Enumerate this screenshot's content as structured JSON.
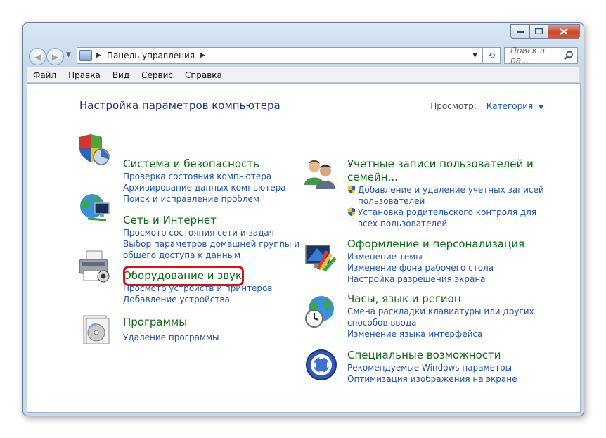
{
  "window": {
    "breadcrumb": "Панель управления",
    "search_placeholder": "Поиск в па..."
  },
  "menu": [
    "Файл",
    "Правка",
    "Вид",
    "Сервис",
    "Справка"
  ],
  "header": {
    "title": "Настройка параметров компьютера",
    "view_label": "Просмотр:",
    "view_value": "Категория"
  },
  "left_categories": [
    {
      "title": "Система и безопасность",
      "icon": "shield-icon",
      "links": [
        "Проверка состояния компьютера",
        "Архивирование данных компьютера",
        "Поиск и исправление проблем"
      ]
    },
    {
      "title": "Сеть и Интернет",
      "icon": "network-globe-icon",
      "links": [
        "Просмотр состояния сети и задач",
        "Выбор параметров домашней группы и",
        "общего доступа к данным"
      ]
    },
    {
      "title": "Оборудование и звук",
      "icon": "printer-icon",
      "links": [
        "Просмотр устройств и принтеров",
        "Добавление устройства"
      ]
    },
    {
      "title": "Программы",
      "icon": "programs-disc-icon",
      "links": [
        "Удаление программы"
      ]
    }
  ],
  "right_categories": [
    {
      "title_line1": "Учетные записи пользователей и",
      "title_line2": "семейн...",
      "icon": "users-icon",
      "links": [
        "Добавление и удаление учетных записей",
        "пользователей",
        "Установка родительского контроля для",
        "всех пользователей"
      ]
    },
    {
      "title": "Оформление и персонализация",
      "icon": "display-paint-icon",
      "links": [
        "Изменение темы",
        "Изменение фона рабочего стола",
        "Настройка разрешения экрана"
      ]
    },
    {
      "title": "Часы, язык и регион",
      "icon": "clock-globe-icon",
      "links": [
        "Смена раскладки клавиатуры или других",
        "способов ввода",
        "Изменение языка интерфейса"
      ]
    },
    {
      "title": "Специальные возможности",
      "icon": "accessibility-icon",
      "links": [
        "Рекомендуемые Windows параметры",
        "Оптимизация изображения на экране"
      ]
    }
  ],
  "colors": {
    "category_title": "#0b6a15",
    "link": "#1e55a6",
    "heading": "#1e3287",
    "highlight": "#d21418"
  }
}
